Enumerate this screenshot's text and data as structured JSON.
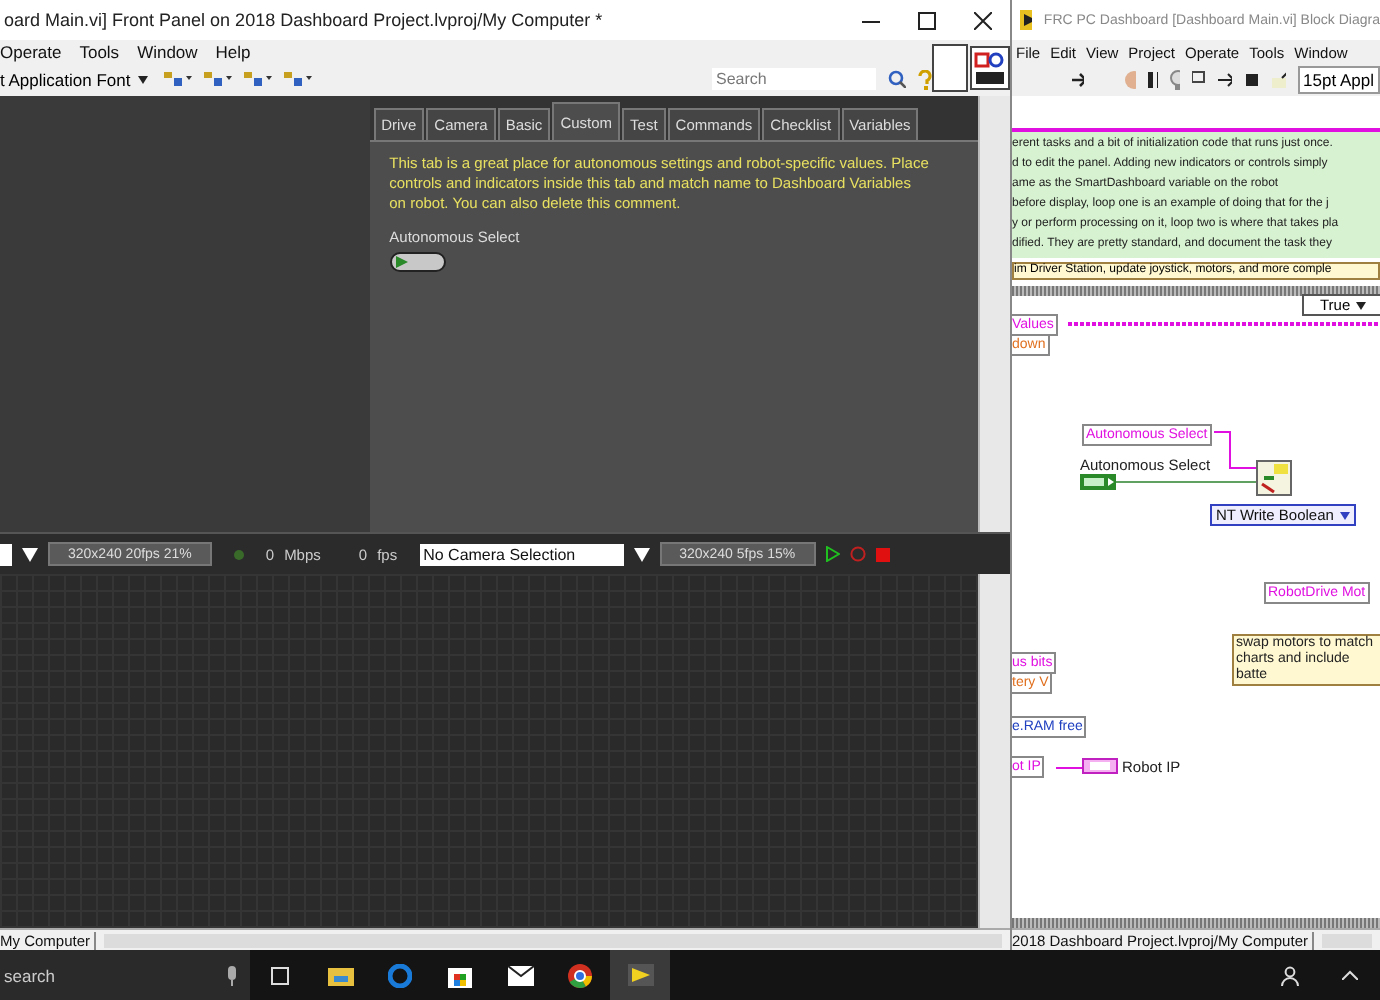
{
  "front_panel": {
    "title": "oard Main.vi] Front Panel on 2018 Dashboard Project.lvproj/My Computer *",
    "menu": [
      "Operate",
      "Tools",
      "Window",
      "Help"
    ],
    "font_selector": "t Application Font",
    "search": {
      "placeholder": "Search"
    },
    "tabs": [
      {
        "label": "Drive",
        "selected": false
      },
      {
        "label": "Camera",
        "selected": false
      },
      {
        "label": "Basic",
        "selected": false
      },
      {
        "label": "Custom",
        "selected": true
      },
      {
        "label": "Test",
        "selected": false
      },
      {
        "label": "Commands",
        "selected": false
      },
      {
        "label": "Checklist",
        "selected": false
      },
      {
        "label": "Variables",
        "selected": false
      }
    ],
    "tab_content": {
      "description": "This tab is a great place for autonomous settings and robot-specific values. Place controls and indicators inside this tab and match name to Dashboard Variables on robot. You can also delete this comment.",
      "control": {
        "label": "Autonomous Select",
        "on": false
      }
    },
    "camera_bar": {
      "left_stats": "320x240  20fps  21%",
      "bandwidth": "0",
      "bandwidth_unit": "Mbps",
      "framerate": "0",
      "framerate_unit": "fps",
      "camera_selection": "No Camera Selection",
      "right_stats": "320x240  5fps  15%"
    },
    "status": "My Computer"
  },
  "block_diagram": {
    "title": "FRC PC Dashboard [Dashboard Main.vi] Block Diagra",
    "menu": [
      "File",
      "Edit",
      "View",
      "Project",
      "Operate",
      "Tools",
      "Window"
    ],
    "font_selector": "15pt Appl",
    "comment_lines": [
      "erent tasks and a bit of initialization code that runs just once.",
      "d to edit the panel. Adding new indicators or controls simply",
      "ame as the SmartDashboard variable on the robot",
      "before display, loop one is an example of doing that for the j",
      "y or perform processing on it, loop two is where that takes pla",
      "dified. They are pretty standard, and document the task they"
    ],
    "yellow_note": "im Driver Station, update joystick, motors, and more comple",
    "case_selector": "True",
    "nodes": [
      {
        "kind": "label",
        "text": "Values",
        "color": "#e010e0"
      },
      {
        "kind": "label",
        "text": "down",
        "color": "#e07020"
      },
      {
        "kind": "label",
        "text": "Autonomous Select",
        "color": "#e010e0"
      },
      {
        "kind": "text",
        "text": "Autonomous Select"
      },
      {
        "kind": "bool-terminal"
      },
      {
        "kind": "nt-node"
      },
      {
        "kind": "dropdown",
        "text": "NT Write Boolean"
      },
      {
        "kind": "label",
        "text": "RobotDrive Mot",
        "color": "#e010e0"
      },
      {
        "kind": "label",
        "text": "us bits",
        "color": "#e010e0"
      },
      {
        "kind": "label",
        "text": "tery V",
        "color": "#e07020"
      },
      {
        "kind": "note",
        "text": "swap motors to match charts and include batte"
      },
      {
        "kind": "label",
        "text": "e.RAM free",
        "color": "#2040c0"
      },
      {
        "kind": "label",
        "text": "ot IP",
        "color": "#e010e0"
      },
      {
        "kind": "string-terminal"
      },
      {
        "kind": "text",
        "text": "Robot IP"
      }
    ],
    "status": "2018 Dashboard Project.lvproj/My Computer"
  },
  "taskbar": {
    "search": {
      "placeholder": "search"
    }
  }
}
